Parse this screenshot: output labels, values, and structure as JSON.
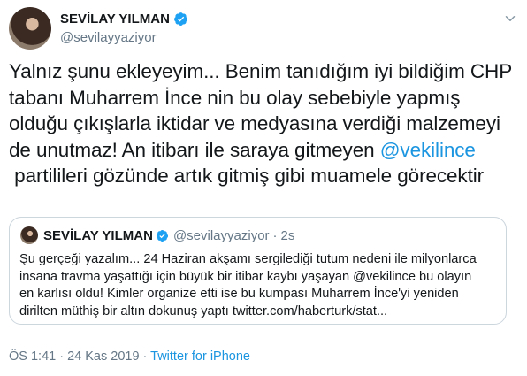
{
  "tweet": {
    "author_name": "SEVİLAY YILMAN",
    "author_handle": "@sevilayyaziyor",
    "text_lines": [
      "Yalnız şunu ekleyeyim... Benim tanıdığım iyi bildiğim CHP",
      "tabanı Muharrem İnce nin bu olay sebebiyle yapmış",
      "olduğu çıkışlarla iktidar ve medyasına verdiği malzemeyi",
      "de unutmaz! An itibarı ile saraya gitmeyen ",
      " partilileri gözünde artık gitmiş gibi muamele görecektir"
    ],
    "mention": "@vekilince",
    "timestamp": "ÖS 1:41 · 24 Kas 2019 · ",
    "source": "Twitter for iPhone"
  },
  "quoted": {
    "author_name": "SEVİLAY YILMAN",
    "author_handle": "@sevilayyaziyor",
    "separator": "·",
    "time": "2s",
    "text_lines": [
      "Şu gerçeği yazalım... 24 Haziran akşamı sergilediği tutum nedeni ile milyonlarca",
      "insana travma yaşattığı için büyük bir itibar kaybı yaşayan @vekilince bu olayın",
      "en karlısı oldu! Kimler organize etti ise bu kumpası Muharrem İnce'yi yeniden",
      "dirilten müthiş bir altın dokunuş yaptı twitter.com/haberturk/stat..."
    ]
  },
  "colors": {
    "link": "#1b95e0",
    "verified": "#1da1f2",
    "secondary_text": "#657786",
    "border": "#ccd6dd"
  },
  "icons": [
    "verified-badge-icon",
    "chevron-down-icon"
  ]
}
